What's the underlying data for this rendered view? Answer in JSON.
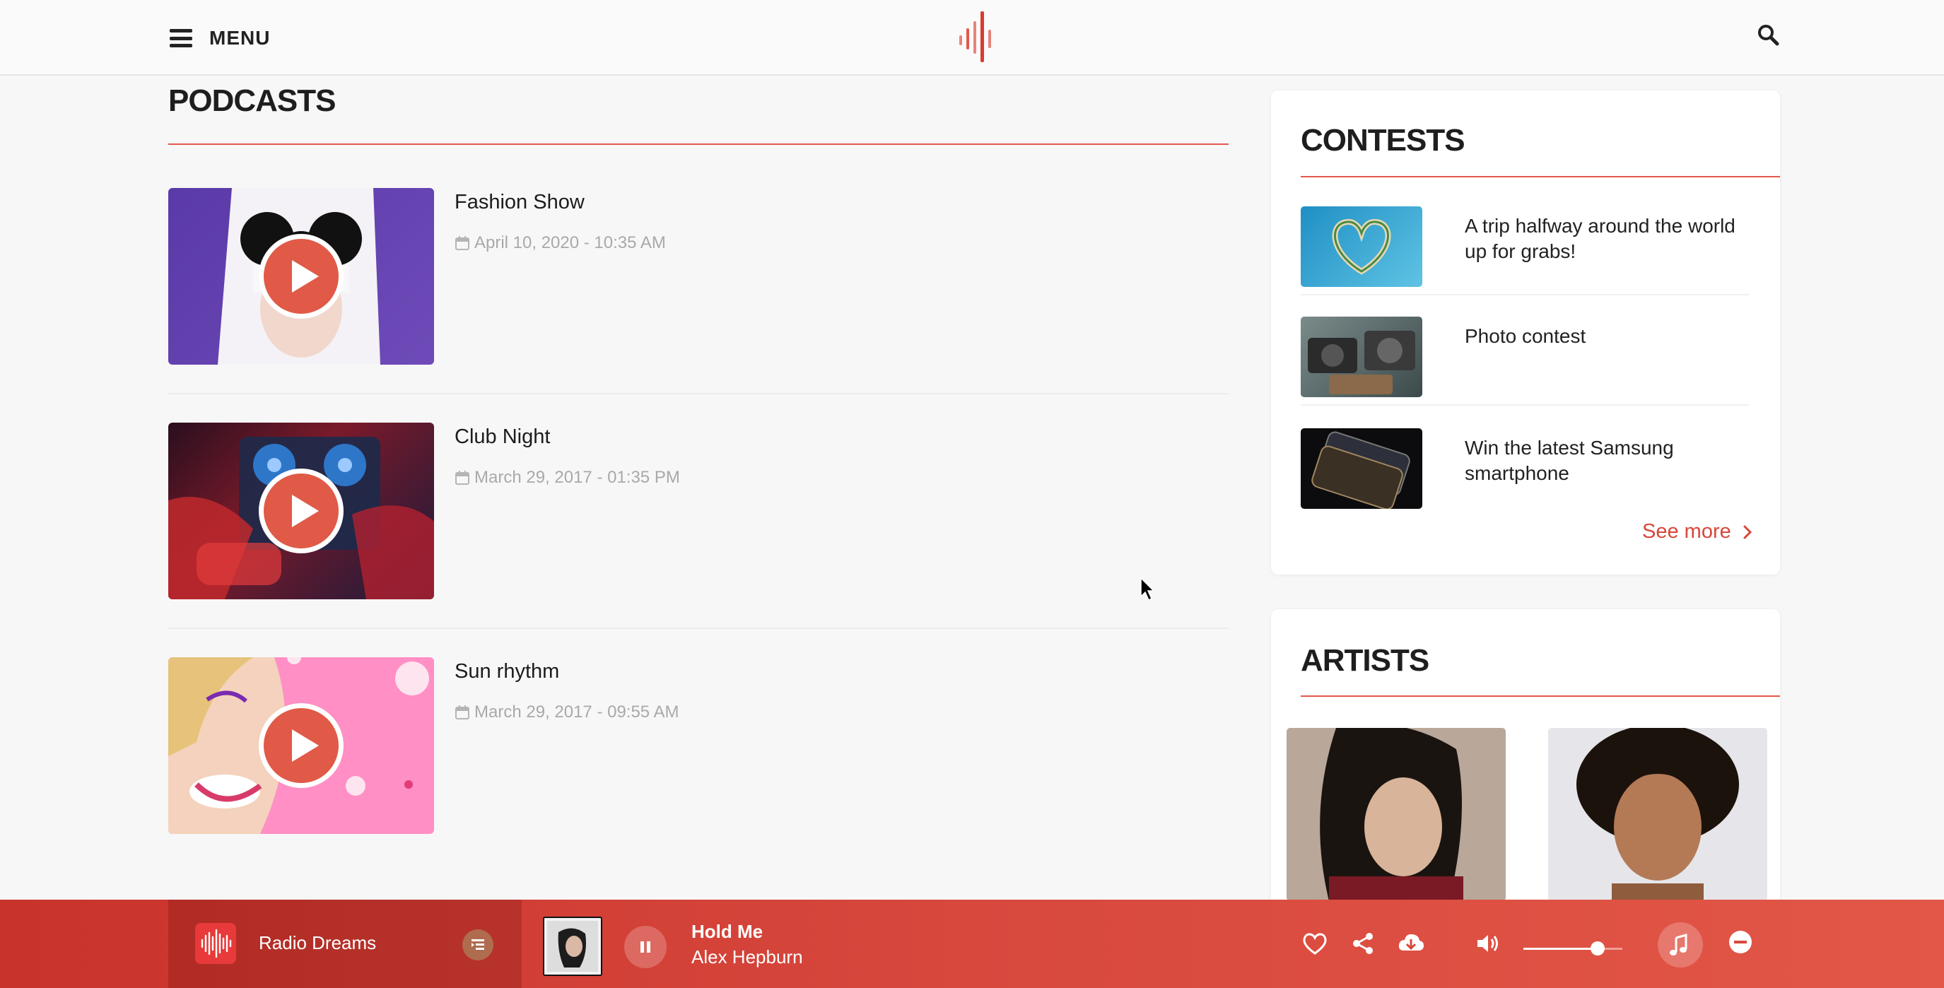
{
  "header": {
    "menu_label": "MENU"
  },
  "podcasts": {
    "title": "PODCASTS",
    "items": [
      {
        "title": "Fashion Show",
        "date": "April 10, 2020 - 10:35 AM"
      },
      {
        "title": "Club Night",
        "date": "March 29, 2017 - 01:35 PM"
      },
      {
        "title": "Sun rhythm",
        "date": "March 29, 2017 - 09:55 AM"
      }
    ]
  },
  "contests": {
    "title": "CONTESTS",
    "items": [
      {
        "text": "A trip halfway around the world up for grabs!"
      },
      {
        "text": "Photo contest"
      },
      {
        "text": "Win the latest Samsung smartphone"
      }
    ],
    "see_more": "See more"
  },
  "artists": {
    "title": "ARTISTS"
  },
  "player": {
    "station": "Radio Dreams",
    "track_title": "Hold Me",
    "track_artist": "Alex Hepburn",
    "volume": 0.75
  },
  "colors": {
    "accent": "#e4574a",
    "player_bg": "#d8483d"
  }
}
